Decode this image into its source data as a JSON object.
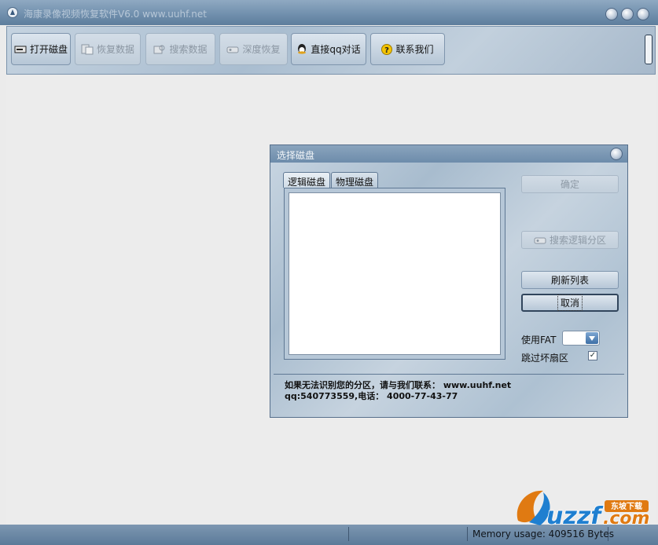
{
  "window": {
    "title": "海康录像视频恢复软件V6.0 www.uuhf.net"
  },
  "toolbar": {
    "buttons": [
      {
        "label": "打开磁盘",
        "icon": "disk-icon"
      },
      {
        "label": "恢复数据",
        "icon": "restore-icon"
      },
      {
        "label": "搜索数据",
        "icon": "search-data-icon"
      },
      {
        "label": "深度恢复",
        "icon": "deep-recover-icon"
      },
      {
        "label": "直接qq对话",
        "icon": "qq-icon"
      },
      {
        "label": "联系我们",
        "icon": "help-icon"
      }
    ]
  },
  "dialog": {
    "title": "选择磁盘",
    "tabs": [
      "逻辑磁盘",
      "物理磁盘"
    ],
    "buttons": {
      "ok": "确定",
      "search_partition": "搜索逻辑分区",
      "refresh": "刷新列表",
      "cancel": "取消"
    },
    "use_fat_label": "使用FAT",
    "skip_bad_label": "跳过坏扇区",
    "skip_bad_checked": true,
    "info_line1": "如果无法识别您的分区，请与我们联系： www.uuhf.net",
    "info_line2": "qq:540773559,电话： 4000-77-43-77"
  },
  "statusbar": {
    "memory": "Memory usage: 409516 Bytes"
  },
  "watermark": {
    "text": "uzzf.com",
    "tagline": "东坡下载"
  },
  "colors": {
    "titlebar": "#6f8eac",
    "panel": "#b6c7d7",
    "accent": "#3d6fa6"
  }
}
